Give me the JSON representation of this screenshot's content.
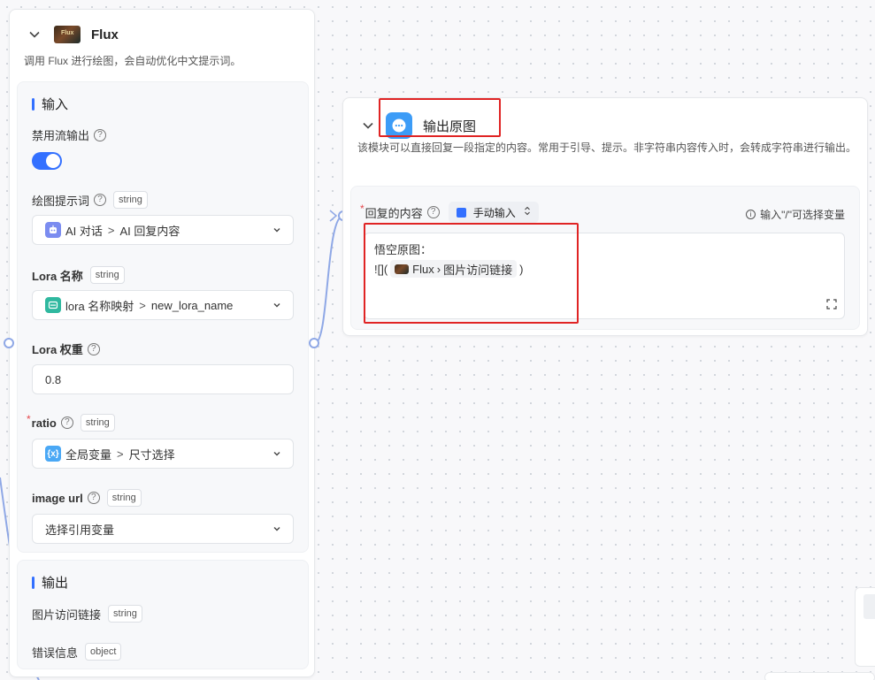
{
  "flux_node": {
    "title": "Flux",
    "thumb_text": "Flux",
    "description": "调用 Flux 进行绘图，会自动优化中文提示词。",
    "input_section": {
      "title": "输入",
      "disable_stream": {
        "label": "禁用流输出",
        "help": "?",
        "enabled": true
      },
      "prompt": {
        "label": "绘图提示词",
        "type": "string",
        "source": "AI 对话",
        "separator": ">",
        "value": "AI 回复内容"
      },
      "lora_name": {
        "label": "Lora 名称",
        "type": "string",
        "source": "lora 名称映射",
        "separator": ">",
        "value": "new_lora_name"
      },
      "lora_weight": {
        "label": "Lora 权重",
        "value": "0.8"
      },
      "ratio": {
        "label": "ratio",
        "required": "*",
        "type": "string",
        "source": "全局变量",
        "separator": ">",
        "value": "尺寸选择"
      },
      "image_url": {
        "label": "image url",
        "type": "string",
        "placeholder": "选择引用变量"
      }
    },
    "output_section": {
      "title": "输出",
      "items": [
        {
          "name": "图片访问链接",
          "type": "string"
        },
        {
          "name": "错误信息",
          "type": "object"
        }
      ]
    }
  },
  "output_node": {
    "title": "输出原图",
    "description": "该模块可以直接回复一段指定的内容。常用于引导、提示。非字符串内容传入时，会转成字符串进行输出。",
    "reply": {
      "required": "*",
      "label": "回复的内容",
      "mode": "手动输入",
      "hint": "输入\"/\"可选择变量",
      "line1": "悟空原图：",
      "prefix": "![](",
      "chip_source": "Flux",
      "chip_sep": "›",
      "chip_value": "图片访问链接",
      "suffix": ")"
    }
  },
  "colors": {
    "accent": "#3370ff",
    "highlight": "#e02424",
    "chat_icon": "#3c9cf7"
  }
}
